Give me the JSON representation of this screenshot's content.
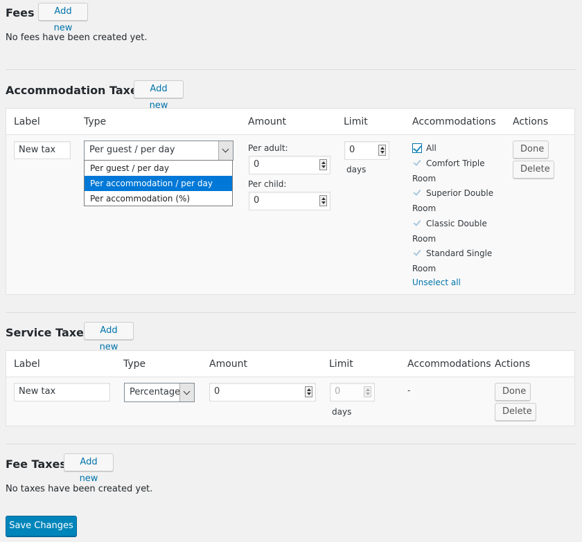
{
  "fees": {
    "title": "Fees",
    "add_new": "Add new",
    "empty": "No fees have been created yet."
  },
  "accommodation_taxes": {
    "title": "Accommodation Taxes",
    "add_new": "Add new",
    "headers": [
      "Label",
      "Type",
      "Amount",
      "Limit",
      "Accommodations",
      "Actions"
    ],
    "row": {
      "label_value": "New tax",
      "type_selected": "Per guest / per day",
      "type_options": [
        "Per guest / per day",
        "Per accommodation / per day",
        "Per accommodation (%)"
      ],
      "type_highlighted": "Per accommodation / per day",
      "per_adult_label": "Per adult:",
      "per_adult_value": "0",
      "per_child_label": "Per child:",
      "per_child_value": "0",
      "limit_value": "0",
      "limit_unit": "days",
      "accommodations": [
        {
          "line1": "All",
          "line2": "",
          "checked": true
        },
        {
          "line1": "Comfort Triple",
          "line2": "Room",
          "checked": true
        },
        {
          "line1": "Superior Double",
          "line2": "Room",
          "checked": true
        },
        {
          "line1": "Classic Double",
          "line2": "Room",
          "checked": true
        },
        {
          "line1": "Standard Single",
          "line2": "Room",
          "checked": true
        }
      ],
      "unselect_all": "Unselect all",
      "done": "Done",
      "delete": "Delete"
    }
  },
  "service_taxes": {
    "title": "Service Taxes",
    "add_new": "Add new",
    "headers": [
      "Label",
      "Type",
      "Amount",
      "Limit",
      "Accommodations",
      "Actions"
    ],
    "row": {
      "label_value": "New tax",
      "type_selected": "Percentage",
      "amount_value": "0",
      "limit_value": "0",
      "limit_unit": "days",
      "accommodations": "-",
      "done": "Done",
      "delete": "Delete"
    }
  },
  "fee_taxes": {
    "title": "Fee Taxes",
    "add_new": "Add new",
    "empty": "No taxes have been created yet."
  },
  "save_changes": "Save Changes",
  "colors": {
    "background": "#f1f1f1",
    "link": "#0073aa",
    "primary": "#0085ba",
    "highlight": "#0078d7"
  }
}
